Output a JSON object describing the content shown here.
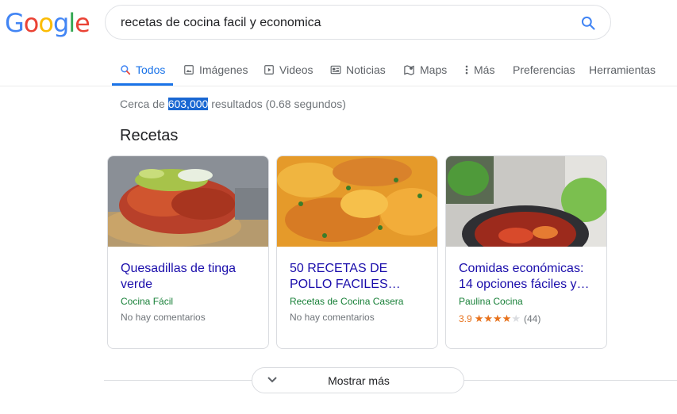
{
  "logo": [
    "G",
    "o",
    "o",
    "g",
    "l",
    "e"
  ],
  "logo_colors": [
    "#4285f4",
    "#ea4335",
    "#fbbc05",
    "#4285f4",
    "#34a853",
    "#ea4335"
  ],
  "search": {
    "query": "recetas de cocina facil y economica"
  },
  "tabs": [
    {
      "label": "Todos",
      "icon": "search-icon",
      "active": true
    },
    {
      "label": "Imágenes",
      "icon": "image-icon"
    },
    {
      "label": "Videos",
      "icon": "play-icon"
    },
    {
      "label": "Noticias",
      "icon": "news-icon"
    },
    {
      "label": "Maps",
      "icon": "map-pin-icon"
    },
    {
      "label": "Más",
      "icon": "more-vert-icon"
    },
    {
      "label": "Preferencias"
    },
    {
      "label": "Herramientas"
    }
  ],
  "stats": {
    "prefix": "Cerca de ",
    "count": "603,000",
    "suffix": " resultados (0.68 segundos)"
  },
  "recipes": {
    "title": "Recetas",
    "cards": [
      {
        "title_lines": [
          "Quesadillas de tinga",
          "verde"
        ],
        "source": "Cocina Fácil",
        "meta": "No hay comentarios"
      },
      {
        "title_lines": [
          "50 RECETAS DE",
          "POLLO FACILES…"
        ],
        "source": "Recetas de Cocina Casera",
        "meta": "No hay comentarios"
      },
      {
        "title_lines": [
          "Comidas económicas:",
          "14 opciones fáciles y…"
        ],
        "source": "Paulina Cocina",
        "rating": {
          "value": "3.9",
          "stars": 4,
          "count": "(44)"
        }
      }
    ]
  },
  "more": {
    "label": "Mostrar más"
  },
  "colors": {
    "accent": "#1a73e8",
    "link": "#1a0dab",
    "source": "#188038",
    "star": "#e7711b"
  }
}
